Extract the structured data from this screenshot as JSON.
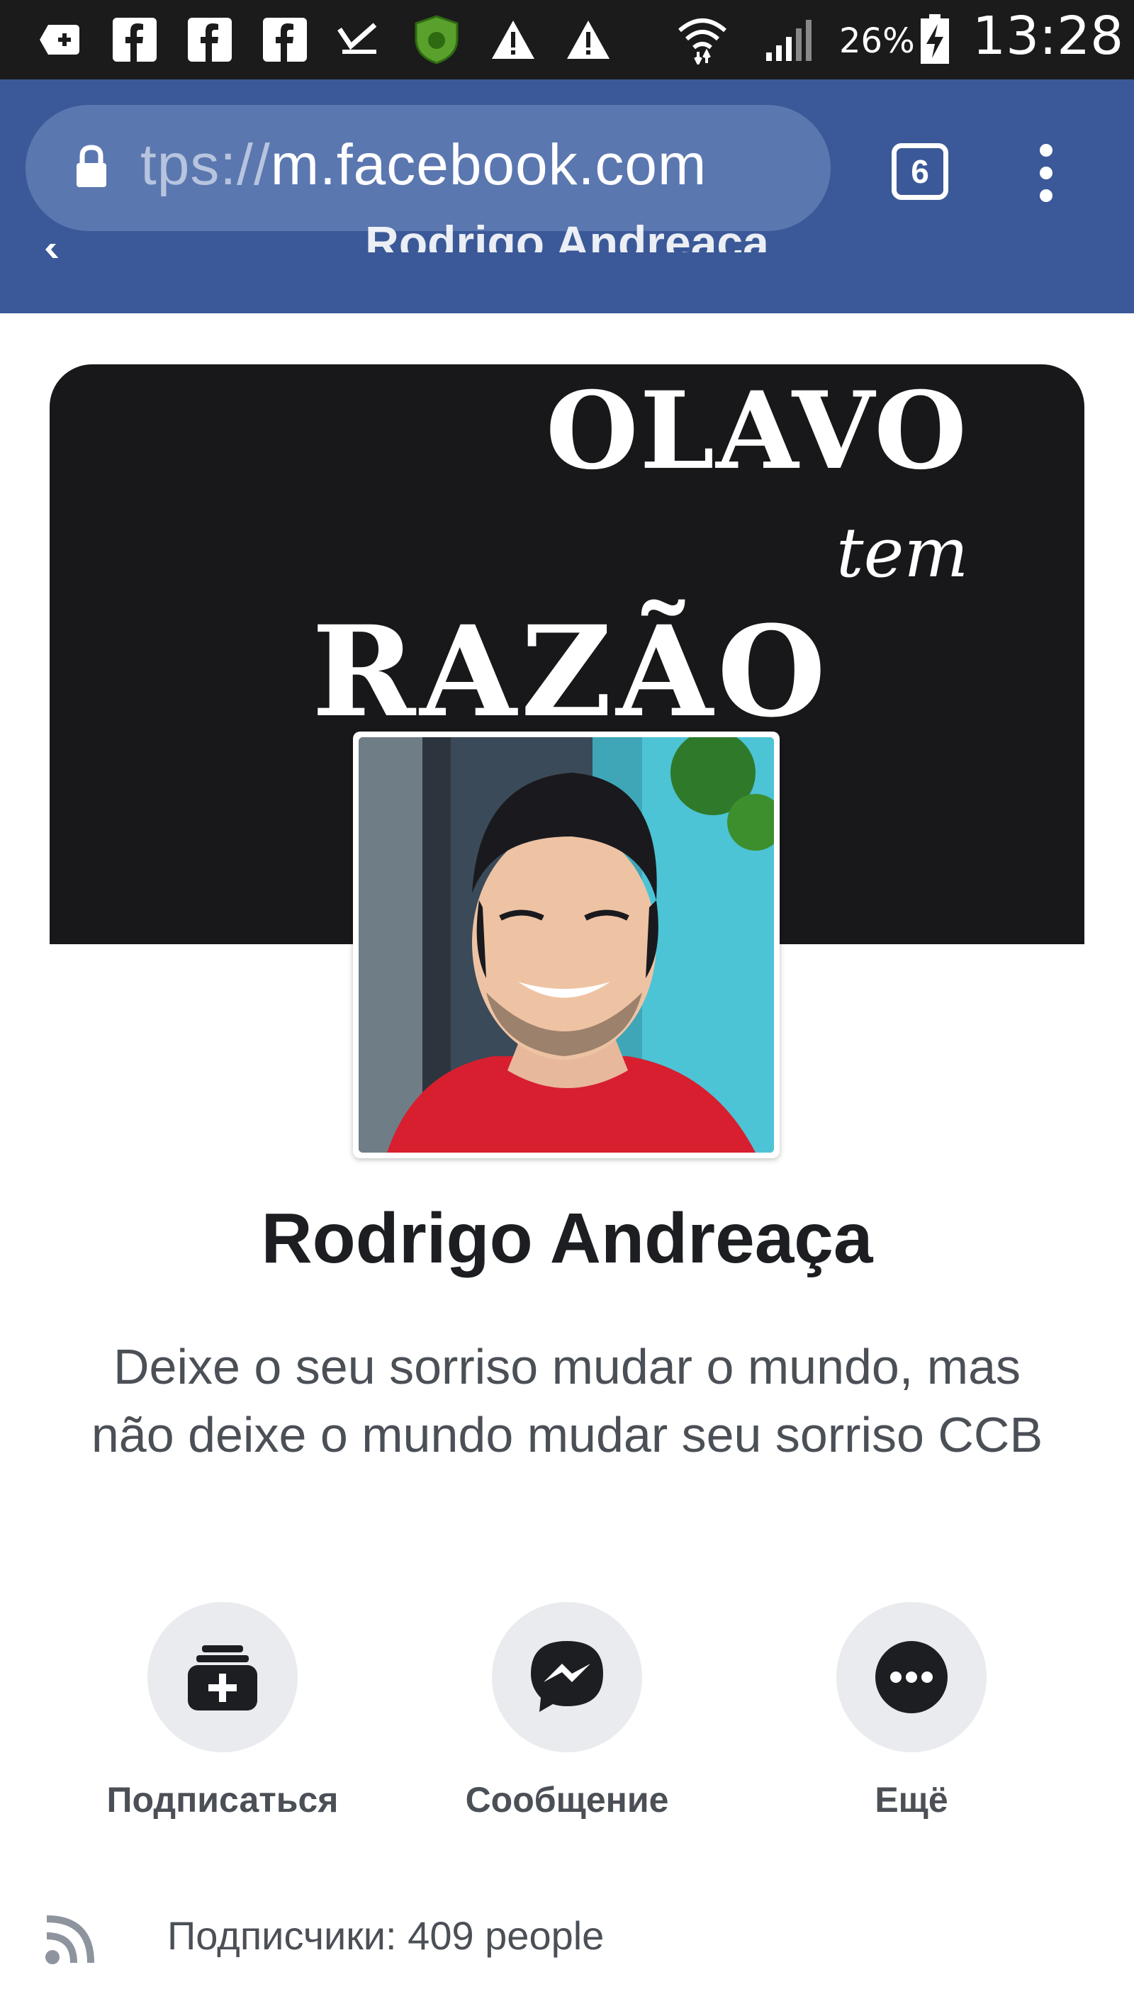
{
  "status_bar": {
    "battery": "26%",
    "time": "13:28",
    "icons": [
      "plus-box-icon",
      "facebook-icon",
      "facebook-icon",
      "facebook-icon",
      "check-download-icon",
      "shield-icon",
      "warning-icon",
      "warning-icon",
      "wifi-icon",
      "signal-icon",
      "battery-charging-icon"
    ]
  },
  "browser": {
    "url_scheme": "tps://",
    "url_host": "m.facebook.com",
    "tab_count": "6",
    "page_title": "Rodrigo Andreaça"
  },
  "cover": {
    "line1": "OLAVO",
    "line2": "tem",
    "line3": "RAZÃO"
  },
  "profile": {
    "name": "Rodrigo Andreaça",
    "bio": "Deixe o seu sorriso mudar o mundo, mas não deixe o mundo mudar seu sorriso CCB"
  },
  "actions": [
    {
      "label": "Подписаться",
      "icon": "subscribe-icon"
    },
    {
      "label": "Сообщение",
      "icon": "messenger-icon"
    },
    {
      "label": "Ещё",
      "icon": "more-icon"
    }
  ],
  "followers": {
    "text": "Подписчики: 409 people",
    "icon": "rss-icon"
  },
  "colors": {
    "facebook_blue": "#3b5998",
    "url_pill": "#5b77b0",
    "action_bg": "#e9ebee",
    "text_dark": "#1c1e21",
    "text_muted": "#4b4f56"
  }
}
